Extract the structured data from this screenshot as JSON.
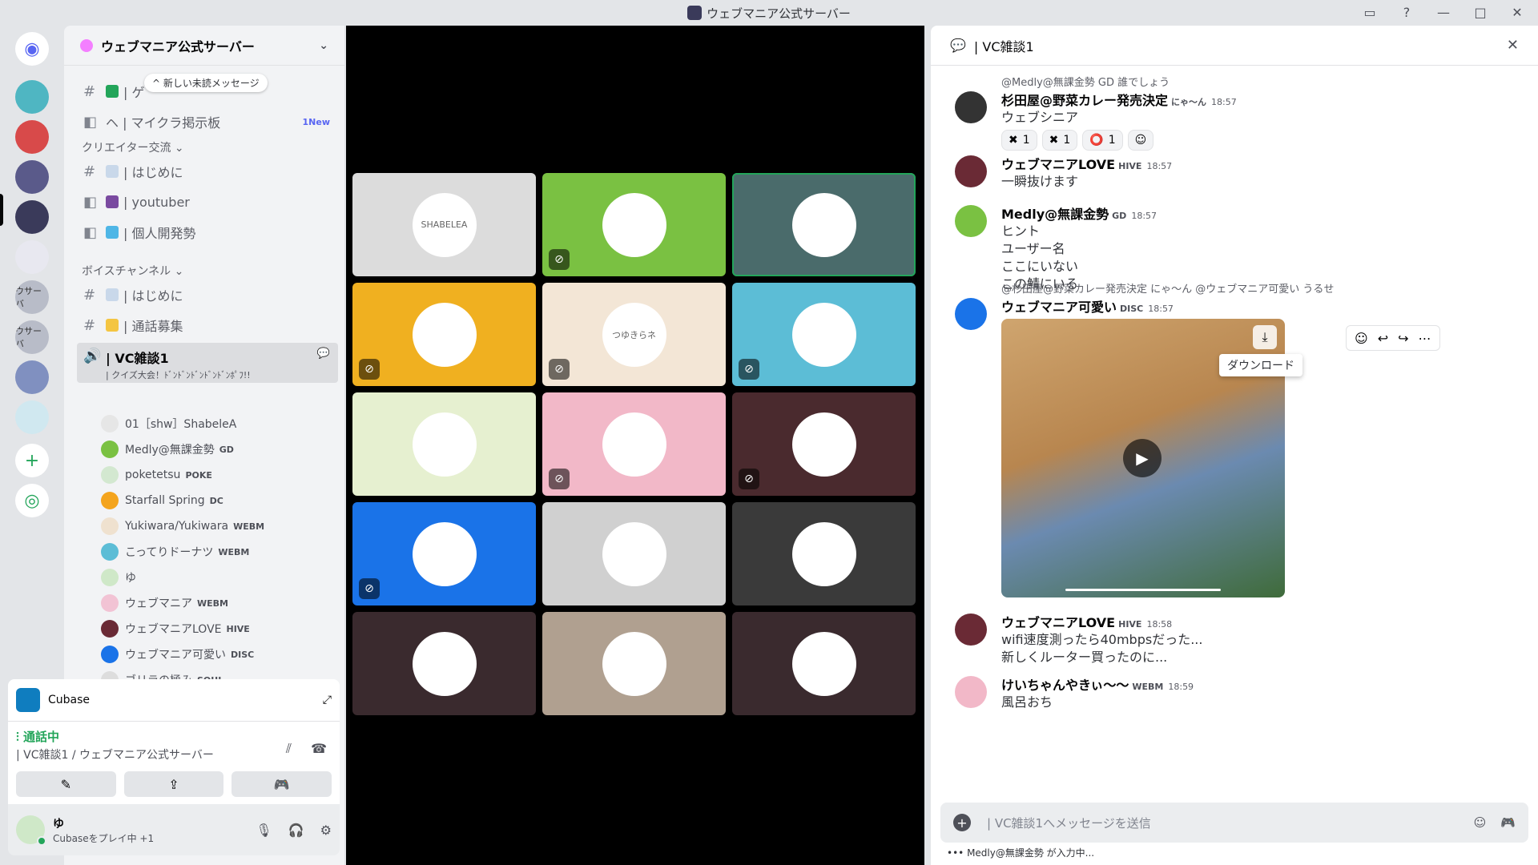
{
  "window": {
    "title": "ウェブマニア公式サーバー"
  },
  "server": {
    "name": "ウェブマニア公式サーバー"
  },
  "channels": {
    "unread_pill": "新しい未読メッセージ",
    "items": [
      {
        "name": "| ゲ",
        "icon": "#"
      },
      {
        "name": "ヘ | マイクラ掲示板",
        "badge": "1New"
      }
    ],
    "cat1": "クリエイター交流",
    "cat1_items": [
      "| はじめに",
      "| youtuber",
      "| 個人開発勢"
    ],
    "cat2": "ボイスチャンネル",
    "cat2_items": [
      "| はじめに",
      "| 通話募集"
    ],
    "vc_name": "| VC雑談1",
    "vc_topic": "| クイズ大会！ﾄﾞﾝﾄﾞﾝﾄﾞﾝﾄﾞﾝﾄﾞﾝﾎﾟﾌ!!"
  },
  "members": [
    {
      "name": "01［shw］ShabeleA",
      "tag": "",
      "color": "#e6e6e6"
    },
    {
      "name": "Medly@無課金勢",
      "tag": "GD",
      "color": "#7ac142"
    },
    {
      "name": "poketetsu",
      "tag": "POKE",
      "color": "#d3e8d0"
    },
    {
      "name": "Starfall Spring",
      "tag": "DC",
      "color": "#f4a41d"
    },
    {
      "name": "Yukiwara/Yukiwara",
      "tag": "WEBM",
      "color": "#efe1cf"
    },
    {
      "name": "こってりドーナツ",
      "tag": "WEBM",
      "color": "#5cbdd6"
    },
    {
      "name": "ゆ",
      "tag": "",
      "color": "#cfe8c8"
    },
    {
      "name": "ウェブマニア",
      "tag": "WEBM",
      "color": "#f2c3d4"
    },
    {
      "name": "ウェブマニアLOVE",
      "tag": "HIVE",
      "color": "#6a2a35"
    },
    {
      "name": "ウェブマニア可愛い",
      "tag": "DISC",
      "color": "#1a73e8"
    },
    {
      "name": "ゴリラの極み",
      "tag": "SOUL",
      "color": "#ddd"
    }
  ],
  "activity": {
    "app": "Cubase"
  },
  "voice": {
    "status": "通話中",
    "location": "| VC雑談1 / ウェブマニア公式サーバー"
  },
  "user": {
    "name": "ゆ",
    "status": "Cubaseをプレイ中 +1"
  },
  "tiles": [
    {
      "label": "SHABELEA",
      "bg": "#dcdcdc",
      "muted": false
    },
    {
      "label": "",
      "bg": "#7ac142",
      "muted": true
    },
    {
      "label": "",
      "bg": "#4a6b6b",
      "muted": false
    },
    {
      "label": "",
      "bg": "#f0b020",
      "muted": true
    },
    {
      "label": "つゆきらネ",
      "bg": "#f3e6d6",
      "muted": true
    },
    {
      "label": "",
      "bg": "#5cbdd6",
      "muted": true
    },
    {
      "label": "",
      "bg": "#e6f0d0",
      "muted": false
    },
    {
      "label": "",
      "bg": "#f2b8c8",
      "muted": true
    },
    {
      "label": "",
      "bg": "#4a2a2e",
      "muted": true
    },
    {
      "label": "",
      "bg": "#1a73e8",
      "muted": true
    },
    {
      "label": "",
      "bg": "#d0d0d0",
      "muted": false
    },
    {
      "label": "",
      "bg": "#3a3a3a",
      "muted": false
    },
    {
      "label": "",
      "bg": "#3a2a2e",
      "muted": false
    },
    {
      "label": "",
      "bg": "#b0a090",
      "muted": false
    },
    {
      "label": "",
      "bg": "#3a2a2e",
      "muted": false
    }
  ],
  "chat": {
    "header": "| VC雑談1",
    "tooltip": "ダウンロード",
    "composer_placeholder": "| VC雑談1へメッセージを送信",
    "typing": "Medly@無課金勢 が入力中...",
    "messages": [
      {
        "reply": "@Medly@無課金勢 GD 誰でしょう",
        "name": "杉田屋@野菜カレー発売決定",
        "badge": "にゃ〜ん",
        "time": "18:57",
        "lines": [
          "ウェブシニア"
        ],
        "color": "#333"
      },
      {
        "name": "ウェブマニアLOVE",
        "badge": "HIVE",
        "time": "18:57",
        "lines": [
          "一瞬抜けます"
        ],
        "color": "#6a2a35"
      },
      {
        "name": "Medly@無課金勢",
        "badge": "GD",
        "time": "18:57",
        "lines": [
          "ヒント",
          "ユーザー名",
          "ここにいない",
          "この鯖にいる"
        ],
        "color": "#7ac142"
      },
      {
        "reply": "@杉田屋@野菜カレー発売決定 にゃ〜ん @ウェブマニア可愛い うるせ",
        "name": "ウェブマニア可愛い",
        "badge": "DISC",
        "time": "18:57",
        "lines": [],
        "color": "#1a73e8"
      },
      {
        "name": "ウェブマニアLOVE",
        "badge": "HIVE",
        "time": "18:58",
        "lines": [
          "wifi速度測ったら40mbpsだった...",
          "新しくルーター買ったのに..."
        ],
        "color": "#6a2a35"
      },
      {
        "name": "けいちゃんやきぃ〜〜",
        "badge": "WEBM",
        "time": "18:59",
        "lines": [
          "風呂おち"
        ],
        "color": "#f2b8c8"
      }
    ],
    "reactions": [
      {
        "emoji": "✖",
        "count": "1"
      },
      {
        "emoji": "✖",
        "count": "1"
      },
      {
        "emoji": "⭕",
        "count": "1"
      }
    ]
  }
}
